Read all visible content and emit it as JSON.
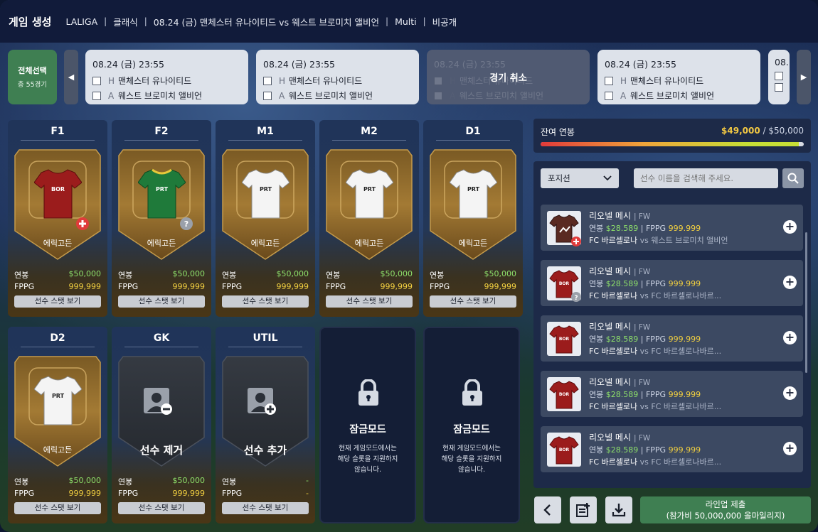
{
  "header": {
    "title": "게임 생성",
    "crumbs": [
      "LALIGA",
      "클래식",
      "08.24 (금) 맨체스터 유나이티드 vs 웨스트 브로미치 앨비언",
      "Multi",
      "비공개"
    ]
  },
  "matches": {
    "select_all": {
      "label": "전체선택",
      "count": "총 55경기"
    },
    "items": [
      {
        "date": "08.24 (금)  23:55",
        "home_tag": "H",
        "home": "맨체스터 유나이티드",
        "away_tag": "A",
        "away": "웨스트 브로미치 앨비언",
        "cancelled": false
      },
      {
        "date": "08.24 (금)  23:55",
        "home_tag": "H",
        "home": "맨체스터 유나이티드",
        "away_tag": "A",
        "away": "웨스트 브로미치 앨비언",
        "cancelled": false
      },
      {
        "date": "08.24 (금)  23:55",
        "home_tag": "H",
        "home": "맨체스터 유나이티드",
        "away_tag": "A",
        "away": "웨스트 브로미치 앨비언",
        "cancelled": true,
        "cancel_label": "경기 취소"
      },
      {
        "date": "08.24 (금)  23:55",
        "home_tag": "H",
        "home": "맨체스터 유나이티드",
        "away_tag": "A",
        "away": "웨스트 브로미치 앨비언",
        "cancelled": false
      },
      {
        "date": "08.",
        "home_tag": "",
        "home": "",
        "away_tag": "",
        "away": "",
        "cancelled": false
      }
    ]
  },
  "slots": {
    "f1": {
      "pos": "F1",
      "name": "에릭고든",
      "team": "BOR",
      "salary_label": "연봉",
      "salary": "$50,000",
      "fppg_label": "FPPG",
      "fppg": "999,999",
      "btn": "선수 스탯 보기",
      "badge": "plus"
    },
    "f2": {
      "pos": "F2",
      "name": "에릭고든",
      "team": "PRT",
      "salary_label": "연봉",
      "salary": "$50,000",
      "fppg_label": "FPPG",
      "fppg": "999,999",
      "btn": "선수 스탯 보기",
      "badge": "question"
    },
    "m1": {
      "pos": "M1",
      "name": "에릭고든",
      "team": "PRT",
      "salary_label": "연봉",
      "salary": "$50,000",
      "fppg_label": "FPPG",
      "fppg": "999,999",
      "btn": "선수 스탯 보기"
    },
    "m2": {
      "pos": "M2",
      "name": "에릭고든",
      "team": "PRT",
      "salary_label": "연봉",
      "salary": "$50,000",
      "fppg_label": "FPPG",
      "fppg": "999,999",
      "btn": "선수 스탯 보기"
    },
    "d1": {
      "pos": "D1",
      "name": "에릭고든",
      "team": "PRT",
      "salary_label": "연봉",
      "salary": "$50,000",
      "fppg_label": "FPPG",
      "fppg": "999,999",
      "btn": "선수 스탯 보기"
    },
    "d2": {
      "pos": "D2",
      "name": "에릭고든",
      "team": "PRT",
      "salary_label": "연봉",
      "salary": "$50,000",
      "fppg_label": "FPPG",
      "fppg": "999,999",
      "btn": "선수 스탯 보기"
    },
    "gk": {
      "pos": "GK",
      "action": "선수 제거",
      "salary_label": "연봉",
      "salary": "$50,000",
      "fppg_label": "FPPG",
      "fppg": "999,999",
      "btn": "선수 스탯 보기"
    },
    "util": {
      "pos": "UTIL",
      "action": "선수 추가",
      "salary_label": "연봉",
      "salary": "-",
      "fppg_label": "FPPG",
      "fppg": "-",
      "btn": "선수 스탯 보기"
    },
    "lock1": {
      "title": "잠금모드",
      "desc1": "현재 게임모드에서는",
      "desc2": "해당 슬롯을 지원하지",
      "desc3": "않습니다."
    },
    "lock2": {
      "title": "잠금모드",
      "desc1": "현재 게임모드에서는",
      "desc2": "해당 슬롯을 지원하지",
      "desc3": "않습니다."
    }
  },
  "salary_cap": {
    "label": "잔여 연봉",
    "remaining": "$49,000",
    "total": "/ $50,000",
    "fill": 0.98
  },
  "player_list": {
    "position_select": "포지션",
    "search_placeholder": "선수 이름을 검색해 주세요.",
    "players": [
      {
        "name": "리오넬 메시",
        "pos": "| FW",
        "salary_label": "연봉",
        "salary": "$28.589",
        "fppg_label": "| FPPG",
        "fppg": "999.999",
        "team": "FC 바르셀로나",
        "opp": "vs 웨스트 브로미치 앨비언",
        "kit": "BOR",
        "badge": "plus"
      },
      {
        "name": "리오넬 메시",
        "pos": "| FW",
        "salary_label": "연봉",
        "salary": "$28.589",
        "fppg_label": "| FPPG",
        "fppg": "999.999",
        "team": "FC 바르셀로나",
        "opp": "vs  FC 바르셀로나바르...",
        "kit": "BOR",
        "badge": "question"
      },
      {
        "name": "리오넬 메시",
        "pos": "| FW",
        "salary_label": "연봉",
        "salary": "$28.589",
        "fppg_label": "| FPPG",
        "fppg": "999.999",
        "team": "FC 바르셀로나",
        "opp": "vs  FC 바르셀로나바르...",
        "kit": "BOR",
        "badge": ""
      },
      {
        "name": "리오넬 메시",
        "pos": "| FW",
        "salary_label": "연봉",
        "salary": "$28.589",
        "fppg_label": "| FPPG",
        "fppg": "999.999",
        "team": "FC 바르셀로나",
        "opp": "vs  FC 바르셀로나바르...",
        "kit": "BOR",
        "badge": ""
      },
      {
        "name": "리오넬 메시",
        "pos": "| FW",
        "salary_label": "연봉",
        "salary": "$28.589",
        "fppg_label": "| FPPG",
        "fppg": "999.999",
        "team": "FC 바르셀로나",
        "opp": "vs  FC 바르셀로나바르...",
        "kit": "BOR",
        "badge": ""
      }
    ]
  },
  "footer": {
    "submit_line1": "라인업 제출",
    "submit_line2": "(참가비 50,000,000 올마일리지)"
  },
  "colors": {
    "accent_green": "#3f7f52",
    "salary_green": "#8ee06a",
    "fppg_yellow": "#f2d040",
    "remaining_yellow": "#f2c843"
  }
}
